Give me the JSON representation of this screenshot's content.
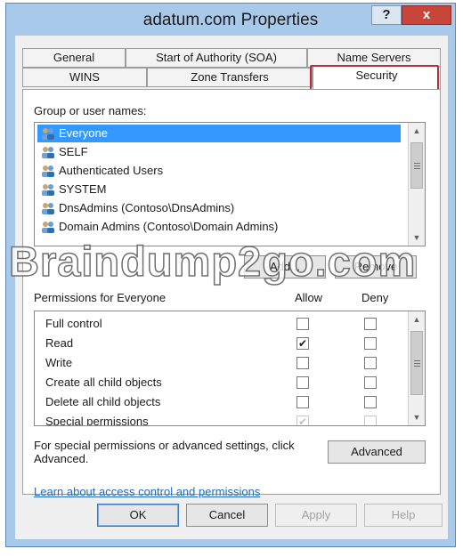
{
  "window": {
    "title": "adatum.com Properties",
    "help_label": "?",
    "close_label": "x"
  },
  "tabs": {
    "row1": [
      "General",
      "Start of Authority (SOA)",
      "Name Servers"
    ],
    "row2": [
      "WINS",
      "Zone Transfers",
      "Security"
    ],
    "active": "Security"
  },
  "security": {
    "group_label": "Group or user names:",
    "users": [
      "Everyone",
      "SELF",
      "Authenticated Users",
      "SYSTEM",
      "DnsAdmins (Contoso\\DnsAdmins)",
      "Domain Admins (Contoso\\Domain Admins)"
    ],
    "selected_user": "Everyone",
    "add_label": "Add...",
    "remove_label": "Remove",
    "permissions_label": "Permissions for Everyone",
    "allow_label": "Allow",
    "deny_label": "Deny",
    "permissions": [
      {
        "name": "Full control",
        "allow": false,
        "deny": false
      },
      {
        "name": "Read",
        "allow": true,
        "deny": false
      },
      {
        "name": "Write",
        "allow": false,
        "deny": false
      },
      {
        "name": "Create all child objects",
        "allow": false,
        "deny": false
      },
      {
        "name": "Delete all child objects",
        "allow": false,
        "deny": false
      },
      {
        "name": "Special permissions",
        "allow": true,
        "deny": false
      }
    ],
    "advanced_text": "For special permissions or advanced settings, click Advanced.",
    "advanced_label": "Advanced",
    "learn_link": "Learn about access control and permissions"
  },
  "footer": {
    "ok_label": "OK",
    "cancel_label": "Cancel",
    "apply_label": "Apply",
    "help_label": "Help"
  },
  "watermark": "Braindump2go.com",
  "colors": {
    "selection": "#3399ff",
    "highlight_border": "#b3303e",
    "close_button": "#c8453a",
    "frame": "#a9c9ea",
    "link": "#1f6cc0"
  }
}
